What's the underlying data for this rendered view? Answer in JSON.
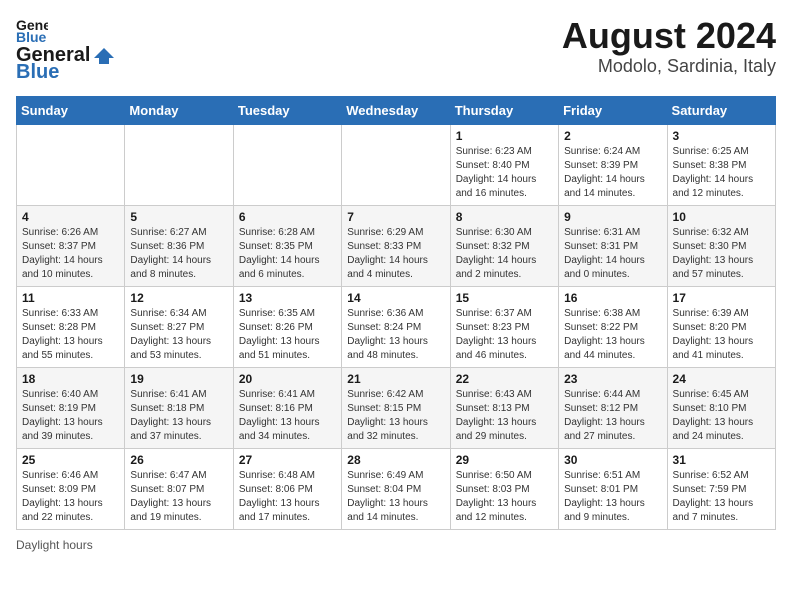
{
  "logo": {
    "general": "General",
    "blue": "Blue"
  },
  "title": "August 2024",
  "subtitle": "Modolo, Sardinia, Italy",
  "days_of_week": [
    "Sunday",
    "Monday",
    "Tuesday",
    "Wednesday",
    "Thursday",
    "Friday",
    "Saturday"
  ],
  "footer": {
    "daylight_label": "Daylight hours"
  },
  "weeks": [
    [
      {
        "day": "",
        "info": ""
      },
      {
        "day": "",
        "info": ""
      },
      {
        "day": "",
        "info": ""
      },
      {
        "day": "",
        "info": ""
      },
      {
        "day": "1",
        "info": "Sunrise: 6:23 AM\nSunset: 8:40 PM\nDaylight: 14 hours and 16 minutes."
      },
      {
        "day": "2",
        "info": "Sunrise: 6:24 AM\nSunset: 8:39 PM\nDaylight: 14 hours and 14 minutes."
      },
      {
        "day": "3",
        "info": "Sunrise: 6:25 AM\nSunset: 8:38 PM\nDaylight: 14 hours and 12 minutes."
      }
    ],
    [
      {
        "day": "4",
        "info": "Sunrise: 6:26 AM\nSunset: 8:37 PM\nDaylight: 14 hours and 10 minutes."
      },
      {
        "day": "5",
        "info": "Sunrise: 6:27 AM\nSunset: 8:36 PM\nDaylight: 14 hours and 8 minutes."
      },
      {
        "day": "6",
        "info": "Sunrise: 6:28 AM\nSunset: 8:35 PM\nDaylight: 14 hours and 6 minutes."
      },
      {
        "day": "7",
        "info": "Sunrise: 6:29 AM\nSunset: 8:33 PM\nDaylight: 14 hours and 4 minutes."
      },
      {
        "day": "8",
        "info": "Sunrise: 6:30 AM\nSunset: 8:32 PM\nDaylight: 14 hours and 2 minutes."
      },
      {
        "day": "9",
        "info": "Sunrise: 6:31 AM\nSunset: 8:31 PM\nDaylight: 14 hours and 0 minutes."
      },
      {
        "day": "10",
        "info": "Sunrise: 6:32 AM\nSunset: 8:30 PM\nDaylight: 13 hours and 57 minutes."
      }
    ],
    [
      {
        "day": "11",
        "info": "Sunrise: 6:33 AM\nSunset: 8:28 PM\nDaylight: 13 hours and 55 minutes."
      },
      {
        "day": "12",
        "info": "Sunrise: 6:34 AM\nSunset: 8:27 PM\nDaylight: 13 hours and 53 minutes."
      },
      {
        "day": "13",
        "info": "Sunrise: 6:35 AM\nSunset: 8:26 PM\nDaylight: 13 hours and 51 minutes."
      },
      {
        "day": "14",
        "info": "Sunrise: 6:36 AM\nSunset: 8:24 PM\nDaylight: 13 hours and 48 minutes."
      },
      {
        "day": "15",
        "info": "Sunrise: 6:37 AM\nSunset: 8:23 PM\nDaylight: 13 hours and 46 minutes."
      },
      {
        "day": "16",
        "info": "Sunrise: 6:38 AM\nSunset: 8:22 PM\nDaylight: 13 hours and 44 minutes."
      },
      {
        "day": "17",
        "info": "Sunrise: 6:39 AM\nSunset: 8:20 PM\nDaylight: 13 hours and 41 minutes."
      }
    ],
    [
      {
        "day": "18",
        "info": "Sunrise: 6:40 AM\nSunset: 8:19 PM\nDaylight: 13 hours and 39 minutes."
      },
      {
        "day": "19",
        "info": "Sunrise: 6:41 AM\nSunset: 8:18 PM\nDaylight: 13 hours and 37 minutes."
      },
      {
        "day": "20",
        "info": "Sunrise: 6:41 AM\nSunset: 8:16 PM\nDaylight: 13 hours and 34 minutes."
      },
      {
        "day": "21",
        "info": "Sunrise: 6:42 AM\nSunset: 8:15 PM\nDaylight: 13 hours and 32 minutes."
      },
      {
        "day": "22",
        "info": "Sunrise: 6:43 AM\nSunset: 8:13 PM\nDaylight: 13 hours and 29 minutes."
      },
      {
        "day": "23",
        "info": "Sunrise: 6:44 AM\nSunset: 8:12 PM\nDaylight: 13 hours and 27 minutes."
      },
      {
        "day": "24",
        "info": "Sunrise: 6:45 AM\nSunset: 8:10 PM\nDaylight: 13 hours and 24 minutes."
      }
    ],
    [
      {
        "day": "25",
        "info": "Sunrise: 6:46 AM\nSunset: 8:09 PM\nDaylight: 13 hours and 22 minutes."
      },
      {
        "day": "26",
        "info": "Sunrise: 6:47 AM\nSunset: 8:07 PM\nDaylight: 13 hours and 19 minutes."
      },
      {
        "day": "27",
        "info": "Sunrise: 6:48 AM\nSunset: 8:06 PM\nDaylight: 13 hours and 17 minutes."
      },
      {
        "day": "28",
        "info": "Sunrise: 6:49 AM\nSunset: 8:04 PM\nDaylight: 13 hours and 14 minutes."
      },
      {
        "day": "29",
        "info": "Sunrise: 6:50 AM\nSunset: 8:03 PM\nDaylight: 13 hours and 12 minutes."
      },
      {
        "day": "30",
        "info": "Sunrise: 6:51 AM\nSunset: 8:01 PM\nDaylight: 13 hours and 9 minutes."
      },
      {
        "day": "31",
        "info": "Sunrise: 6:52 AM\nSunset: 7:59 PM\nDaylight: 13 hours and 7 minutes."
      }
    ]
  ]
}
